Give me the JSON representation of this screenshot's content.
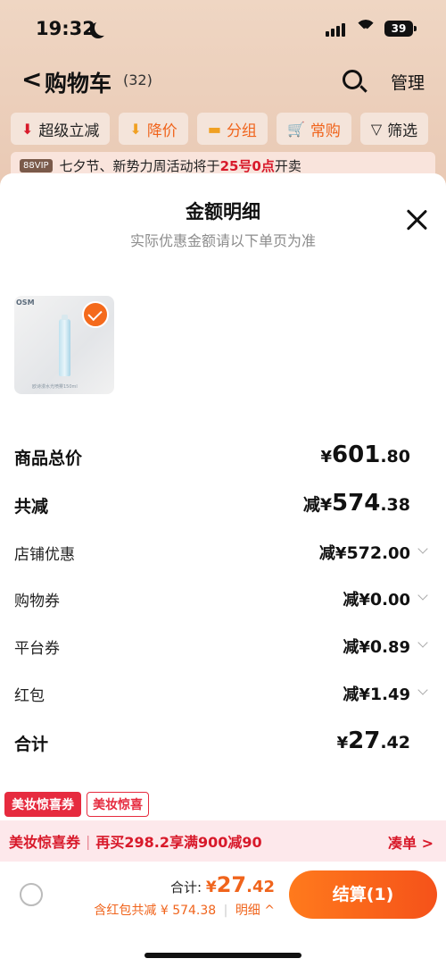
{
  "status": {
    "time": "19:32",
    "battery": "39"
  },
  "nav": {
    "back": "<",
    "title": "购物车",
    "count": "(32)",
    "manage": "管理"
  },
  "chips": [
    {
      "icon": "down-arrow-icon",
      "glyph": "⬇",
      "label": "超级立减"
    },
    {
      "icon": "price-down-icon",
      "glyph": "⬇",
      "label": "降价"
    },
    {
      "icon": "folder-icon",
      "glyph": "▬",
      "label": "分组"
    },
    {
      "icon": "cart-icon",
      "glyph": "🛒",
      "label": "常购"
    },
    {
      "icon": "filter-icon",
      "glyph": "▽",
      "label": "筛选"
    }
  ],
  "notice": {
    "badge": "88VIP",
    "text_pre": "七夕节、新势力周活动将于",
    "highlight": "25号0点",
    "text_post": "开卖"
  },
  "sheet": {
    "title": "金额明细",
    "subtitle": "实际优惠金额请以下单页为准",
    "product_thumb": {
      "brand": "OSM",
      "caption": "欧诗漫水光喷雾150ml"
    },
    "rows": {
      "goods_total": {
        "label": "商品总价",
        "currency": "¥",
        "int": "601",
        "dec": ".80"
      },
      "total_reduce": {
        "label": "共减",
        "prefix": "减¥",
        "int": "574",
        "dec": ".38"
      },
      "shop_discount": {
        "label": "店铺优惠",
        "prefix": "减¥",
        "int": "572",
        "dec": ".00"
      },
      "shopping_coupon": {
        "label": "购物券",
        "prefix": "减¥",
        "int": "0",
        "dec": ".00"
      },
      "platform_coupon": {
        "label": "平台券",
        "prefix": "减¥",
        "int": "0",
        "dec": ".89"
      },
      "red_packet": {
        "label": "红包",
        "prefix": "减¥",
        "int": "1",
        "dec": ".49"
      },
      "sum": {
        "label": "合计",
        "currency": "¥",
        "int": "27",
        "dec": ".42"
      }
    }
  },
  "promo": {
    "tag1": "美妆惊喜券",
    "tag2": "美妆惊喜",
    "bar_title": "美妆惊喜券",
    "bar_text": "再买298.2享满900减90",
    "bar_action": "凑单 >"
  },
  "footer": {
    "total_label": "合计:",
    "currency": "¥",
    "int": "27",
    "dec": ".42",
    "sub_text": "含红包共减 ¥ 574.38",
    "detail": "明细 ^",
    "settle": "结算(1)"
  },
  "colors": {
    "accent": "#f0641c",
    "red": "#e62b3f",
    "settle": "#f5521a"
  }
}
